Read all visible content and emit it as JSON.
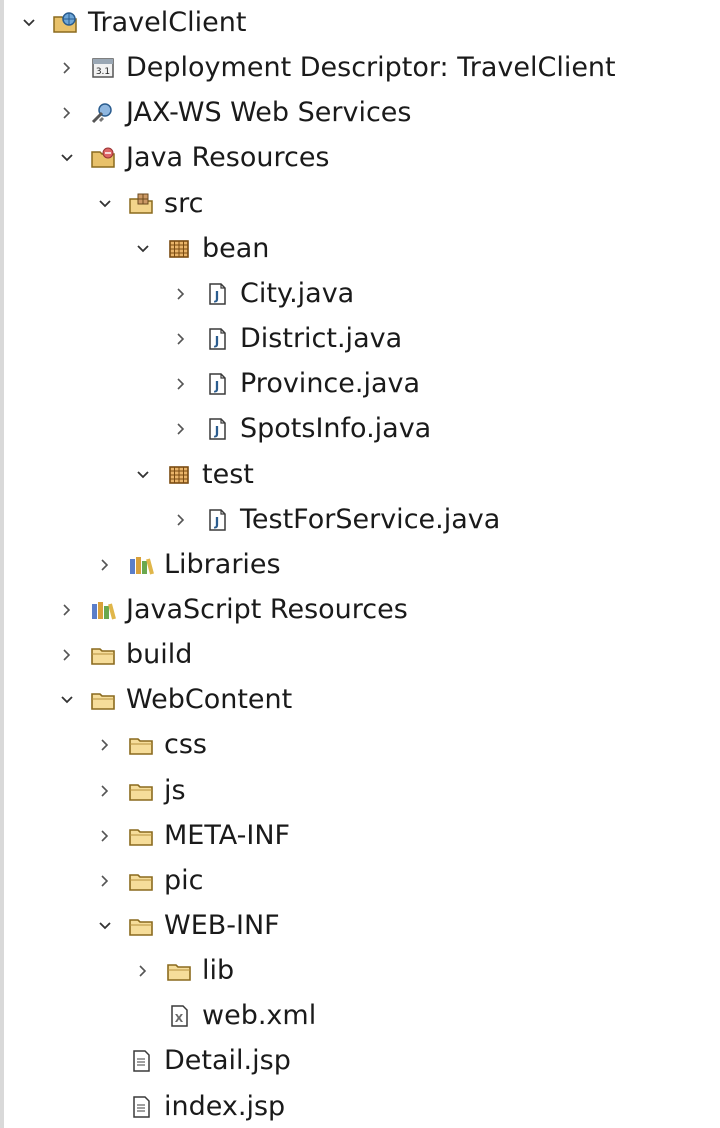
{
  "tree": {
    "items": [
      {
        "label": "TravelClient",
        "depth": 0,
        "state": "expanded",
        "icon": "web-project-icon"
      },
      {
        "label": "Deployment Descriptor: TravelClient",
        "depth": 1,
        "state": "collapsed",
        "icon": "deployment-descriptor-icon"
      },
      {
        "label": "JAX-WS Web Services",
        "depth": 1,
        "state": "collapsed",
        "icon": "web-services-icon"
      },
      {
        "label": "Java Resources",
        "depth": 1,
        "state": "expanded",
        "icon": "java-resources-icon"
      },
      {
        "label": "src",
        "depth": 2,
        "state": "expanded",
        "icon": "source-folder-icon"
      },
      {
        "label": "bean",
        "depth": 3,
        "state": "expanded",
        "icon": "package-icon"
      },
      {
        "label": "City.java",
        "depth": 4,
        "state": "collapsed",
        "icon": "java-file-icon"
      },
      {
        "label": "District.java",
        "depth": 4,
        "state": "collapsed",
        "icon": "java-file-icon"
      },
      {
        "label": "Province.java",
        "depth": 4,
        "state": "collapsed",
        "icon": "java-file-icon"
      },
      {
        "label": "SpotsInfo.java",
        "depth": 4,
        "state": "collapsed",
        "icon": "java-file-icon"
      },
      {
        "label": "test",
        "depth": 3,
        "state": "expanded",
        "icon": "package-icon"
      },
      {
        "label": "TestForService.java",
        "depth": 4,
        "state": "collapsed",
        "icon": "java-file-icon"
      },
      {
        "label": "Libraries",
        "depth": 2,
        "state": "collapsed",
        "icon": "libraries-icon"
      },
      {
        "label": "JavaScript Resources",
        "depth": 1,
        "state": "collapsed",
        "icon": "libraries-icon"
      },
      {
        "label": "build",
        "depth": 1,
        "state": "collapsed",
        "icon": "folder-icon"
      },
      {
        "label": "WebContent",
        "depth": 1,
        "state": "expanded",
        "icon": "folder-icon"
      },
      {
        "label": "css",
        "depth": 2,
        "state": "collapsed",
        "icon": "folder-icon"
      },
      {
        "label": "js",
        "depth": 2,
        "state": "collapsed",
        "icon": "folder-icon"
      },
      {
        "label": "META-INF",
        "depth": 2,
        "state": "collapsed",
        "icon": "folder-icon"
      },
      {
        "label": "pic",
        "depth": 2,
        "state": "collapsed",
        "icon": "folder-icon"
      },
      {
        "label": "WEB-INF",
        "depth": 2,
        "state": "expanded",
        "icon": "folder-icon"
      },
      {
        "label": "lib",
        "depth": 3,
        "state": "collapsed",
        "icon": "folder-icon"
      },
      {
        "label": "web.xml",
        "depth": 3,
        "state": "leaf",
        "icon": "xml-file-icon"
      },
      {
        "label": "Detail.jsp",
        "depth": 2,
        "state": "leaf",
        "icon": "jsp-file-icon"
      },
      {
        "label": "index.jsp",
        "depth": 2,
        "state": "leaf",
        "icon": "jsp-file-icon"
      }
    ]
  }
}
